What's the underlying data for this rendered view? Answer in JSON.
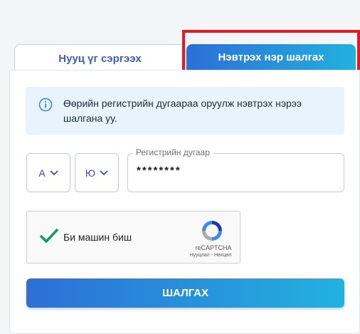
{
  "tabs": [
    {
      "label": "Нууц үг сэргээх",
      "active": false
    },
    {
      "label": "Нэвтрэх нэр шалгах",
      "active": true
    }
  ],
  "info": {
    "icon": "info-circle-icon",
    "text": "Өөрийн регистрийн дугаараа оруулж нэвтрэх нэрээ шалгана уу."
  },
  "register": {
    "letter1": "А",
    "letter2": "Ю",
    "label": "Регистрийн дугаар",
    "value": "********"
  },
  "captcha": {
    "label": "Би машин биш",
    "brand": "reCAPTCHA",
    "links": "Нууцлал - Нөхцөл"
  },
  "submit_label": "ШАЛГАХ",
  "colors": {
    "accent_start": "#2d6fd6",
    "accent_end": "#22b1de",
    "highlight": "#e01b24"
  }
}
